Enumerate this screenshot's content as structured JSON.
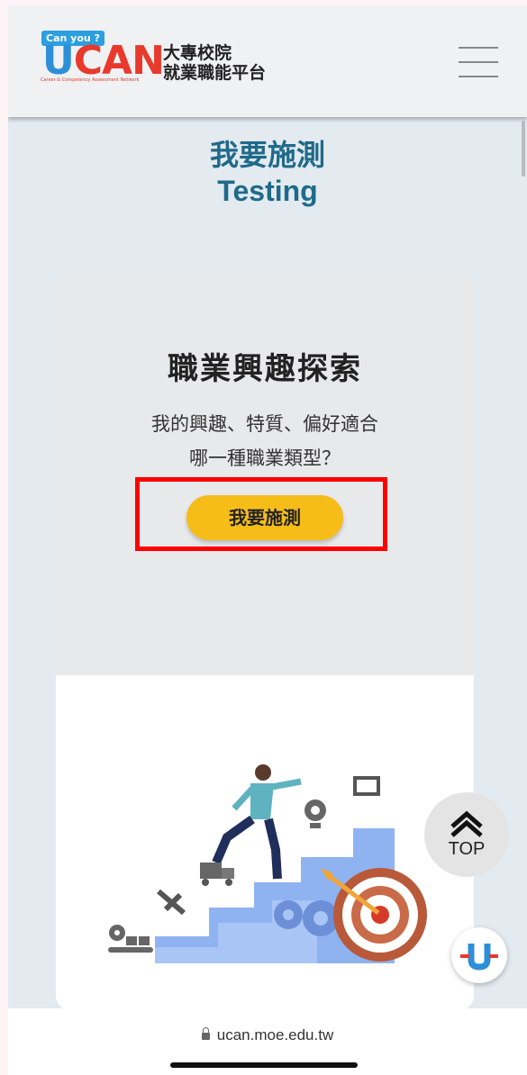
{
  "header": {
    "logo": {
      "badge": "Can you ?",
      "word_u": "U",
      "word_c": "C",
      "word_an": "AN",
      "tagline": "Career & Competency Assessment Network",
      "cn_line1": "大專校院",
      "cn_line2": "就業職能平台"
    },
    "menu_icon": "hamburger-menu-icon"
  },
  "page": {
    "title_cn": "我要施測",
    "title_en": "Testing"
  },
  "card": {
    "title": "職業興趣探索",
    "desc_line1": "我的興趣、特質、偏好適合",
    "desc_line2": "哪一種職業類型？",
    "button_label": "我要施測"
  },
  "floating": {
    "top_label": "TOP",
    "chat_icon": "ucan-assistant-icon"
  },
  "browser": {
    "url": "ucan.moe.edu.tw"
  },
  "colors": {
    "title": "#1f6a8a",
    "button": "#f6bd19",
    "highlight": "#ff0000",
    "page_bg": "#e3eaf0"
  }
}
